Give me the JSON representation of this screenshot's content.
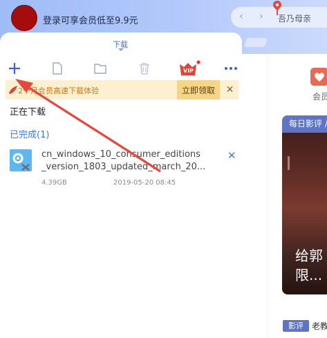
{
  "header": {
    "promo_text": "登录可享会员低至9.9元",
    "nav_back": "‹",
    "nav_forward": "›",
    "address_text": "吾乃母亲"
  },
  "tabs": {
    "active_label": "下载"
  },
  "toolbar": {
    "vip_label": "VIP"
  },
  "banner": {
    "text": "2个月会员高速下载体验",
    "button_label": "立即领取",
    "close_label": "✕"
  },
  "sections": {
    "downloading": "正在下载",
    "completed": "已完成(1)"
  },
  "file": {
    "name_line1": "cn_windows_10_consumer_editions",
    "name_line2": "_version_1803_updated_march_20...",
    "size": "4.39GB",
    "date": "2019-05-20 08:45",
    "remove_label": "✕"
  },
  "right_panel": {
    "vip_label": "会员",
    "card_tag": "每日影评 /",
    "card_title": "给郭\n限...",
    "footer_tag": "影评",
    "footer_text": "老教"
  },
  "colors": {
    "accent": "#3a78e8",
    "banner_bg": "#fdf0d1",
    "banner_button": "#f6d586",
    "arrow": "#e8453c",
    "card_tag": "#5e74c4"
  }
}
